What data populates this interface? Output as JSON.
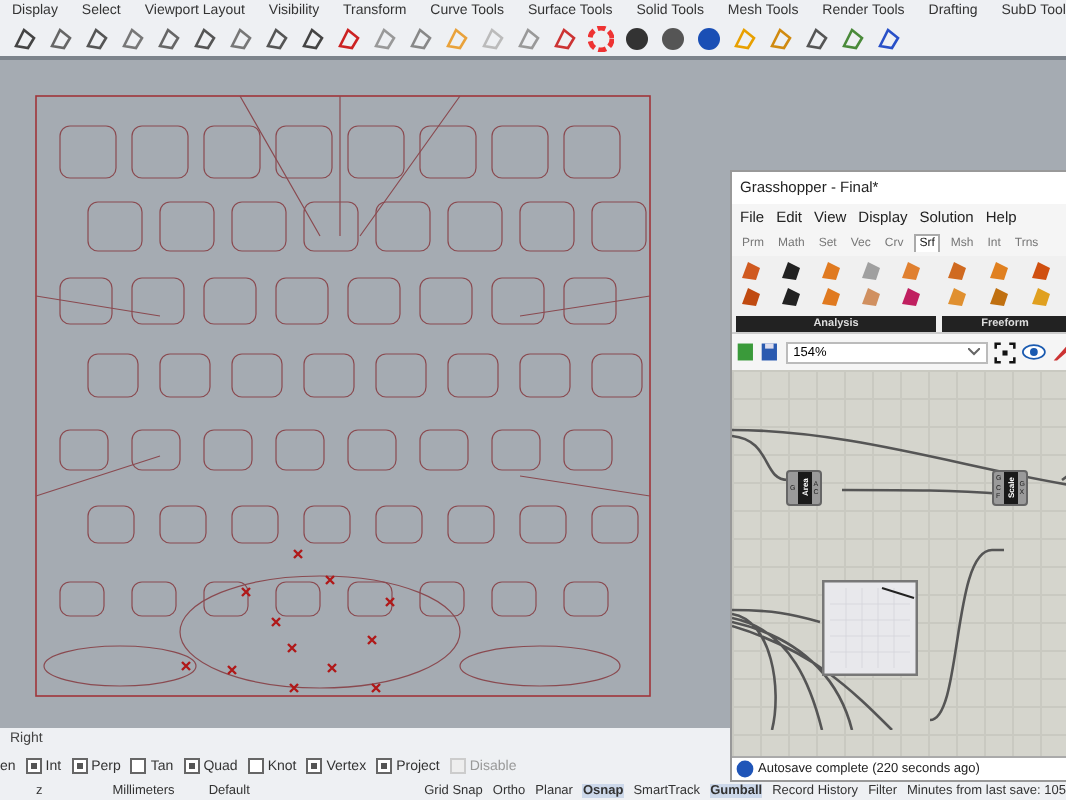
{
  "menu_tabs": [
    "Display",
    "Select",
    "Viewport Layout",
    "Visibility",
    "Transform",
    "Curve Tools",
    "Surface Tools",
    "Solid Tools",
    "Mesh Tools",
    "Render Tools",
    "Drafting",
    "SubD Tool"
  ],
  "viewport": {
    "label": "Right"
  },
  "osnaps": [
    {
      "label": "en"
    },
    {
      "label": "Int",
      "checked": true
    },
    {
      "label": "Perp",
      "checked": true
    },
    {
      "label": "Tan",
      "checked": false
    },
    {
      "label": "Quad",
      "checked": true
    },
    {
      "label": "Knot",
      "checked": false
    },
    {
      "label": "Vertex",
      "checked": true
    },
    {
      "label": "Project",
      "checked": true
    },
    {
      "label": "Disable",
      "checked": false,
      "disabled": true
    }
  ],
  "status_bar": {
    "left": [
      "z",
      "Millimeters",
      "Default"
    ],
    "toggles": [
      {
        "label": "Grid Snap",
        "on": false
      },
      {
        "label": "Ortho",
        "on": false
      },
      {
        "label": "Planar",
        "on": false
      },
      {
        "label": "Osnap",
        "on": true
      },
      {
        "label": "SmartTrack",
        "on": false
      },
      {
        "label": "Gumball",
        "on": true
      },
      {
        "label": "Record History",
        "on": false
      },
      {
        "label": "Filter",
        "on": false
      }
    ],
    "info": "Minutes from last save: 105"
  },
  "grasshopper": {
    "title": "Grasshopper - Final*",
    "menu": [
      "File",
      "Edit",
      "View",
      "Display",
      "Solution",
      "Help"
    ],
    "tabs": [
      {
        "label": "Prm",
        "selected": false
      },
      {
        "label": "Math",
        "selected": false
      },
      {
        "label": "Set",
        "selected": false
      },
      {
        "label": "Vec",
        "selected": false
      },
      {
        "label": "Crv",
        "selected": false
      },
      {
        "label": "Srf",
        "selected": true
      },
      {
        "label": "Msh",
        "selected": false
      },
      {
        "label": "Int",
        "selected": false
      },
      {
        "label": "Trns",
        "selected": false
      }
    ],
    "panels": [
      "Analysis",
      "Freeform"
    ],
    "zoom": "154%",
    "nodes": [
      {
        "name": "Area",
        "inputs": [
          "G"
        ],
        "outputs": [
          "A",
          "C"
        ]
      },
      {
        "name": "Scale",
        "inputs": [
          "G",
          "C",
          "F"
        ],
        "outputs": [
          "G",
          "X"
        ]
      }
    ],
    "status": "Autosave complete (220 seconds ago)"
  }
}
